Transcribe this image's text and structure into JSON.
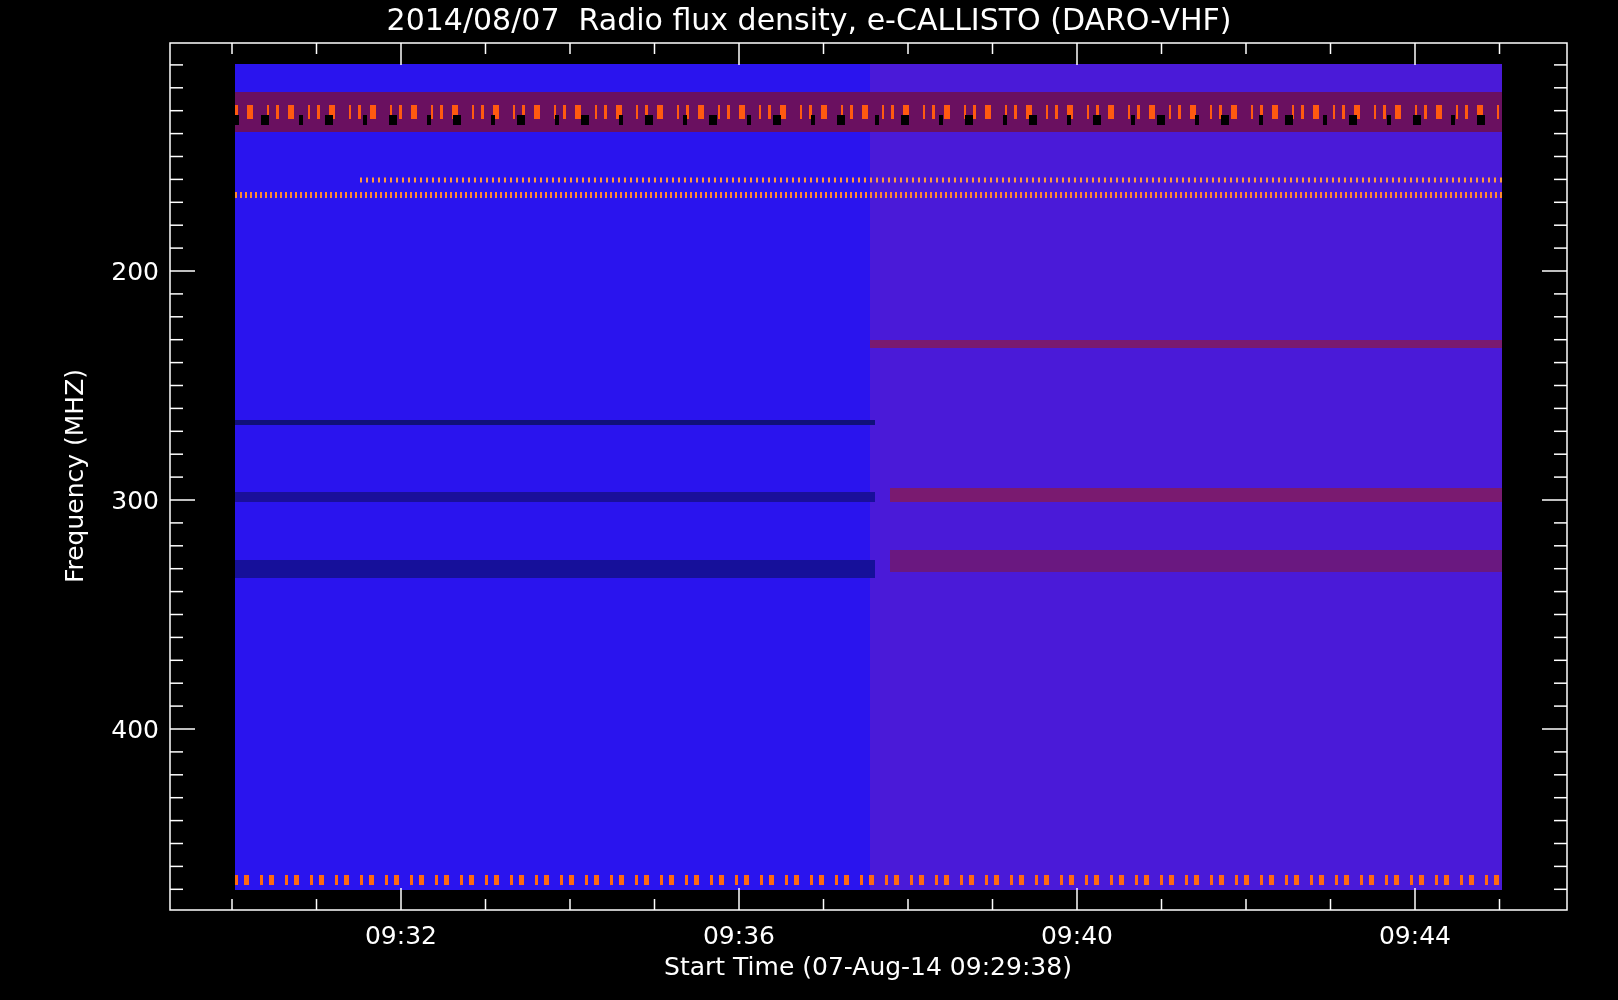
{
  "chart": {
    "title": "2014/08/07  Radio flux density, e-CALLISTO (DARO-VHF)",
    "xlabel": "Start Time (07-Aug-14 09:29:38)",
    "ylabel": "Frequency (MHZ)",
    "xtick_labels": [
      "09:32",
      "09:36",
      "09:40",
      "09:44"
    ],
    "ytick_labels": [
      "200",
      "300",
      "400"
    ]
  }
}
